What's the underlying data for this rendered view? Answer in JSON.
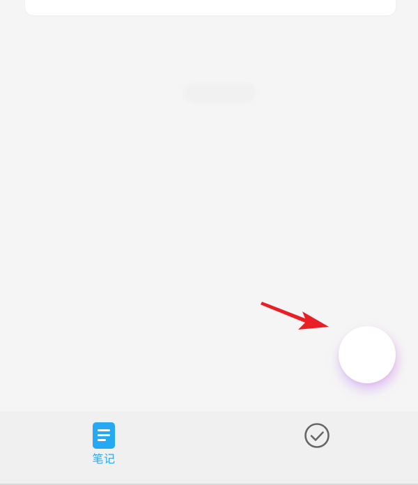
{
  "colors": {
    "background": "#f5f5f5",
    "card": "#ffffff",
    "tab_bar": "#f0f0f0",
    "accent_blue": "#26a9f3",
    "fab_plus_start": "#3d4de8",
    "fab_plus_end": "#b044f5",
    "annotation_red": "#ea1f25",
    "inactive_icon": "#666666"
  },
  "icons": {
    "fab": "plus-icon",
    "annotation": "red-arrow-icon",
    "notes_tab": "document-icon",
    "todo_tab": "check-circle-icon"
  },
  "tabs": [
    {
      "label": "笔记",
      "icon": "document-icon",
      "active": true
    },
    {
      "label": "",
      "icon": "check-circle-icon",
      "active": false
    }
  ]
}
